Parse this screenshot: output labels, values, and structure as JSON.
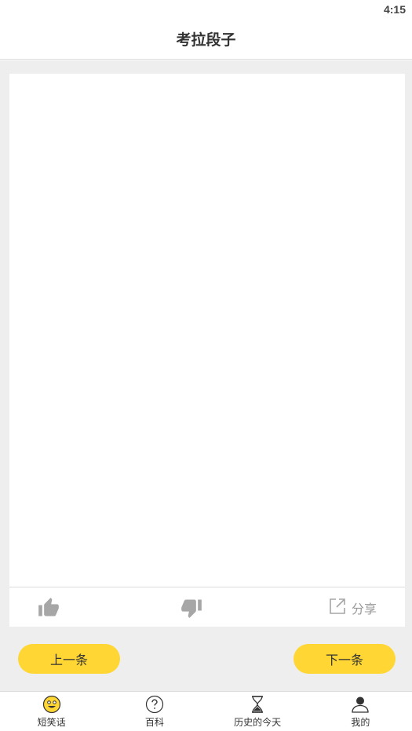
{
  "status_bar": {
    "time": "4:15"
  },
  "header": {
    "title": "考拉段子"
  },
  "actions": {
    "share_label": "分享"
  },
  "nav": {
    "prev_label": "上一条",
    "next_label": "下一条"
  },
  "tabs": [
    {
      "label": "短笑话",
      "icon": "smiley-icon"
    },
    {
      "label": "百科",
      "icon": "question-circle-icon"
    },
    {
      "label": "历史的今天",
      "icon": "hourglass-icon"
    },
    {
      "label": "我的",
      "icon": "person-icon"
    }
  ],
  "colors": {
    "accent": "#ffd633",
    "background": "#eeeeee"
  }
}
